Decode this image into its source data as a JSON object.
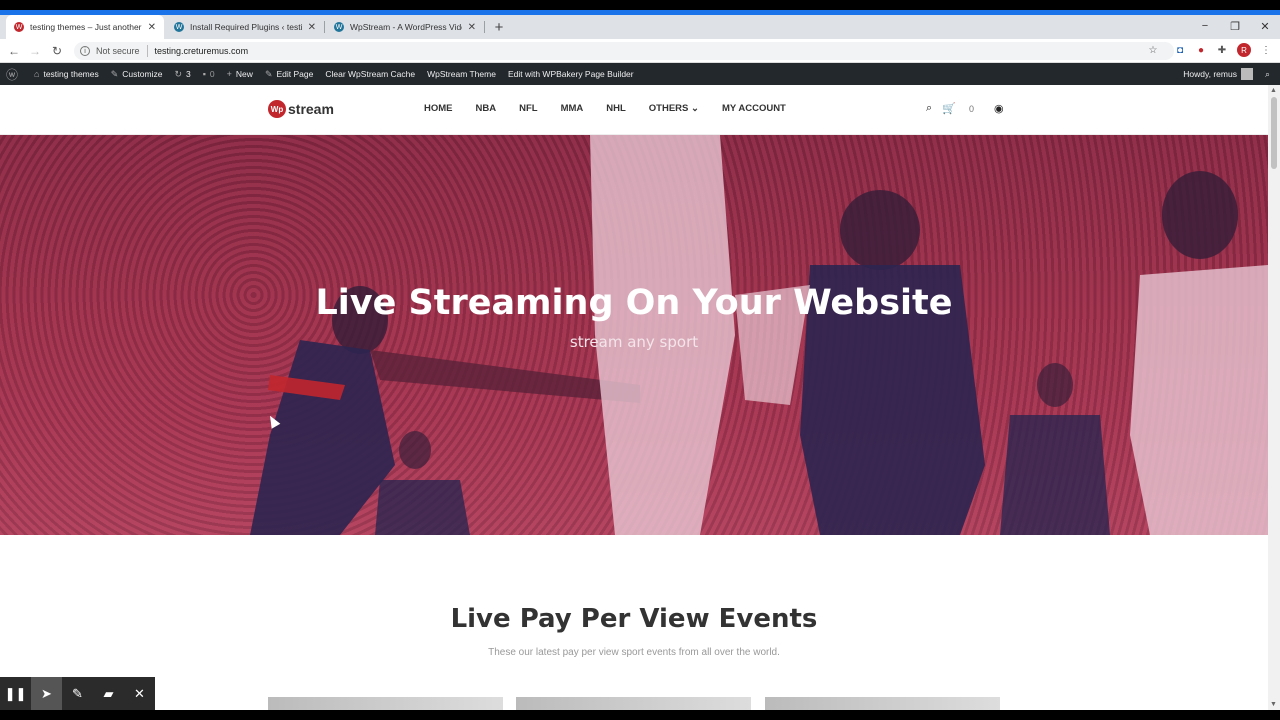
{
  "browser": {
    "tabs": [
      {
        "title": "testing themes – Just another W",
        "active": true,
        "favicon_color": "#c1272d"
      },
      {
        "title": "Install Required Plugins ‹ testing",
        "active": false,
        "favicon_color": "#21759b"
      },
      {
        "title": "WpStream - A WordPress Video",
        "active": false,
        "favicon_color": "#21759b"
      }
    ],
    "new_tab": "+",
    "window_controls": {
      "minimize": "−",
      "maximize": "❐",
      "close": "✕"
    },
    "security_label": "Not secure",
    "url": "testing.creturemus.com"
  },
  "wp_admin_bar": {
    "site_name": "testing themes",
    "customize": "Customize",
    "updates_count": "3",
    "comments_count": "0",
    "new_label": "New",
    "edit_page": "Edit Page",
    "clear_cache": "Clear WpStream Cache",
    "theme": "WpStream Theme",
    "wpbakery": "Edit with WPBakery Page Builder",
    "howdy": "Howdy, remus"
  },
  "site": {
    "logo_mark": "Wp",
    "logo_text": "stream",
    "nav": [
      "HOME",
      "NBA",
      "NFL",
      "MMA",
      "NHL",
      "OTHERS",
      "MY ACCOUNT"
    ],
    "others_chevron": "⌄",
    "cart_count": "0",
    "hero_title": "Live Streaming On Your Website",
    "hero_subtitle": "stream any sport",
    "section_title": "Live Pay Per View Events",
    "section_subtitle": "These our latest pay per view sport events from all over the world."
  },
  "annotation_toolbar": {
    "tools": [
      "pause-icon",
      "pointer-icon",
      "pen-icon",
      "highlighter-icon",
      "close-icon"
    ]
  },
  "colors": {
    "brand": "#c1272d",
    "hero_overlay": "#a8344f",
    "admin_bar": "#23282d",
    "chrome_accent": "#1a73e8"
  }
}
